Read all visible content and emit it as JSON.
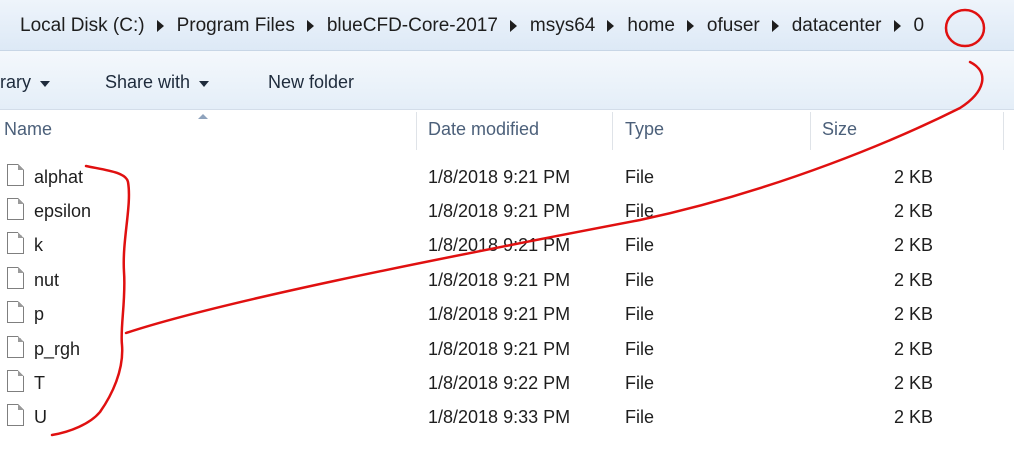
{
  "breadcrumb": [
    "Local Disk (C:)",
    "Program Files",
    "blueCFD-Core-2017",
    "msys64",
    "home",
    "ofuser",
    "datacenter",
    "0"
  ],
  "toolbar": {
    "library_label": "rary",
    "share_label": "Share with",
    "new_folder_label": "New folder"
  },
  "columns": {
    "name": "Name",
    "date": "Date modified",
    "type": "Type",
    "size": "Size"
  },
  "files": [
    {
      "name": "alphat",
      "date": "1/8/2018 9:21 PM",
      "type": "File",
      "size": "2 KB"
    },
    {
      "name": "epsilon",
      "date": "1/8/2018 9:21 PM",
      "type": "File",
      "size": "2 KB"
    },
    {
      "name": "k",
      "date": "1/8/2018 9:21 PM",
      "type": "File",
      "size": "2 KB"
    },
    {
      "name": "nut",
      "date": "1/8/2018 9:21 PM",
      "type": "File",
      "size": "2 KB"
    },
    {
      "name": "p",
      "date": "1/8/2018 9:21 PM",
      "type": "File",
      "size": "2 KB"
    },
    {
      "name": "p_rgh",
      "date": "1/8/2018 9:21 PM",
      "type": "File",
      "size": "2 KB"
    },
    {
      "name": "T",
      "date": "1/8/2018 9:22 PM",
      "type": "File",
      "size": "2 KB"
    },
    {
      "name": "U",
      "date": "1/8/2018 9:33 PM",
      "type": "File",
      "size": "2 KB"
    }
  ],
  "annotation_color": "#e01010"
}
